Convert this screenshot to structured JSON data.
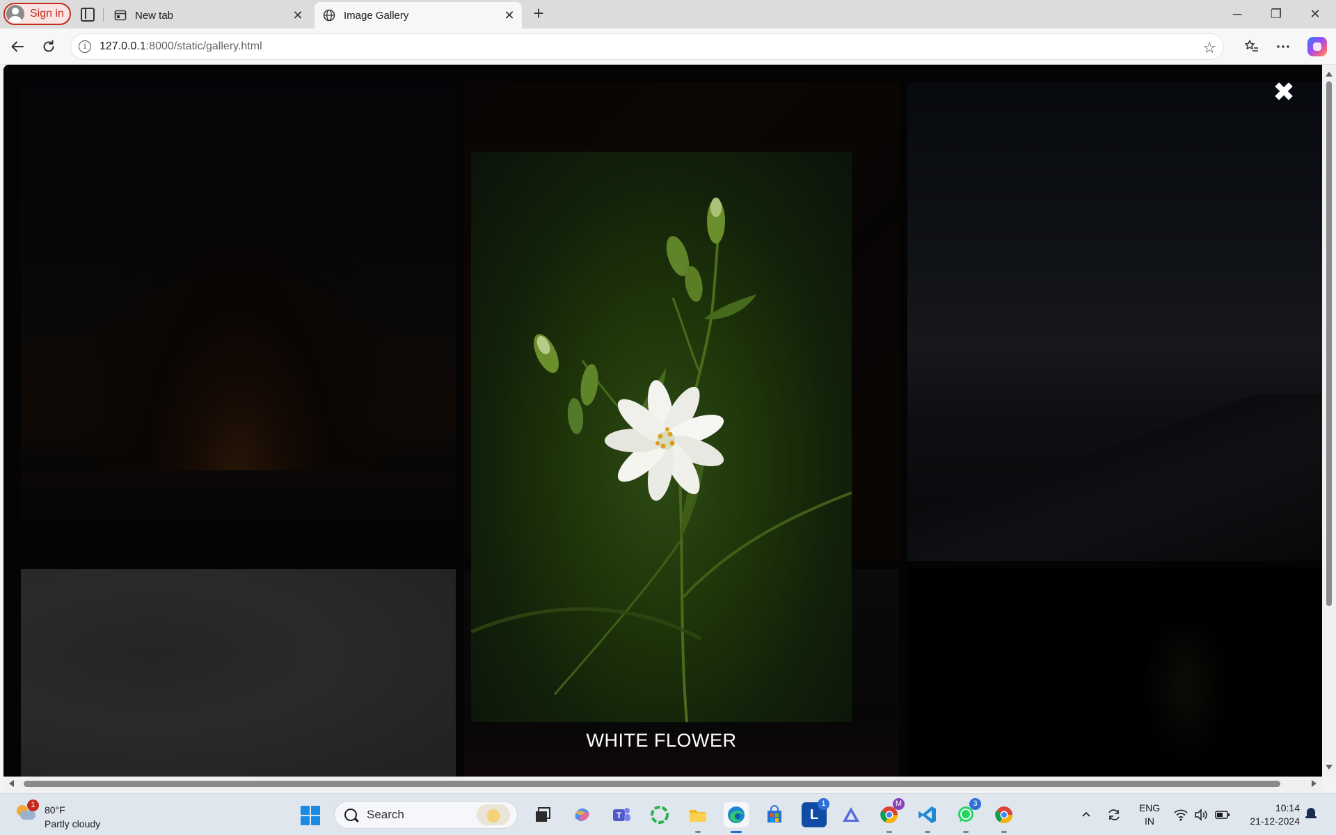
{
  "browser": {
    "profile": {
      "sign_in_label": "Sign in"
    },
    "tabs": [
      {
        "title": "New tab",
        "close": "✕",
        "active": false,
        "icon": "newtab-page-icon"
      },
      {
        "title": "Image Gallery",
        "close": "✕",
        "active": true,
        "icon": "globe-icon"
      }
    ],
    "new_tab_symbol": "+",
    "window_controls": {
      "minimize": "─",
      "restore": "❐",
      "close": "✕"
    },
    "address_bar": {
      "host": "127.0.0.1",
      "path": ":8000/static/gallery.html"
    }
  },
  "page": {
    "thumbnails": [
      {
        "name": "sunset-sea"
      },
      {
        "name": "autumn-leaves"
      },
      {
        "name": "cloudy-mountains"
      },
      {
        "name": "bright-branches"
      },
      {
        "name": "dark-garden"
      },
      {
        "name": "dark-plant"
      }
    ],
    "lightbox": {
      "caption": "WHITE FLOWER",
      "close_symbol": "✖"
    }
  },
  "taskbar": {
    "weather": {
      "badge": "1",
      "temperature": "80°F",
      "condition": "Partly cloudy"
    },
    "search_placeholder": "Search",
    "apps": [
      {
        "name": "task-view",
        "label": ""
      },
      {
        "name": "copilot",
        "label": ""
      },
      {
        "name": "teams",
        "label": ""
      },
      {
        "name": "refresh-app",
        "label": ""
      },
      {
        "name": "file-explorer",
        "label": ""
      },
      {
        "name": "edge",
        "label": ""
      },
      {
        "name": "microsoft-store",
        "label": ""
      },
      {
        "name": "l-app",
        "label": "L",
        "badge": "1"
      },
      {
        "name": "a-app",
        "label": ""
      },
      {
        "name": "chrome-profile",
        "label": "",
        "badge": "M"
      },
      {
        "name": "vscode",
        "label": ""
      },
      {
        "name": "whatsapp",
        "label": "",
        "badge": "3"
      },
      {
        "name": "chrome",
        "label": ""
      }
    ],
    "tray": {
      "chevron": "^",
      "language_line1": "ENG",
      "language_line2": "IN",
      "time": "10:14",
      "date": "21-12-2024"
    }
  },
  "colors": {
    "accent": "#1c6fd1",
    "signin_red": "#c42b1c",
    "overlay": "#000000"
  }
}
